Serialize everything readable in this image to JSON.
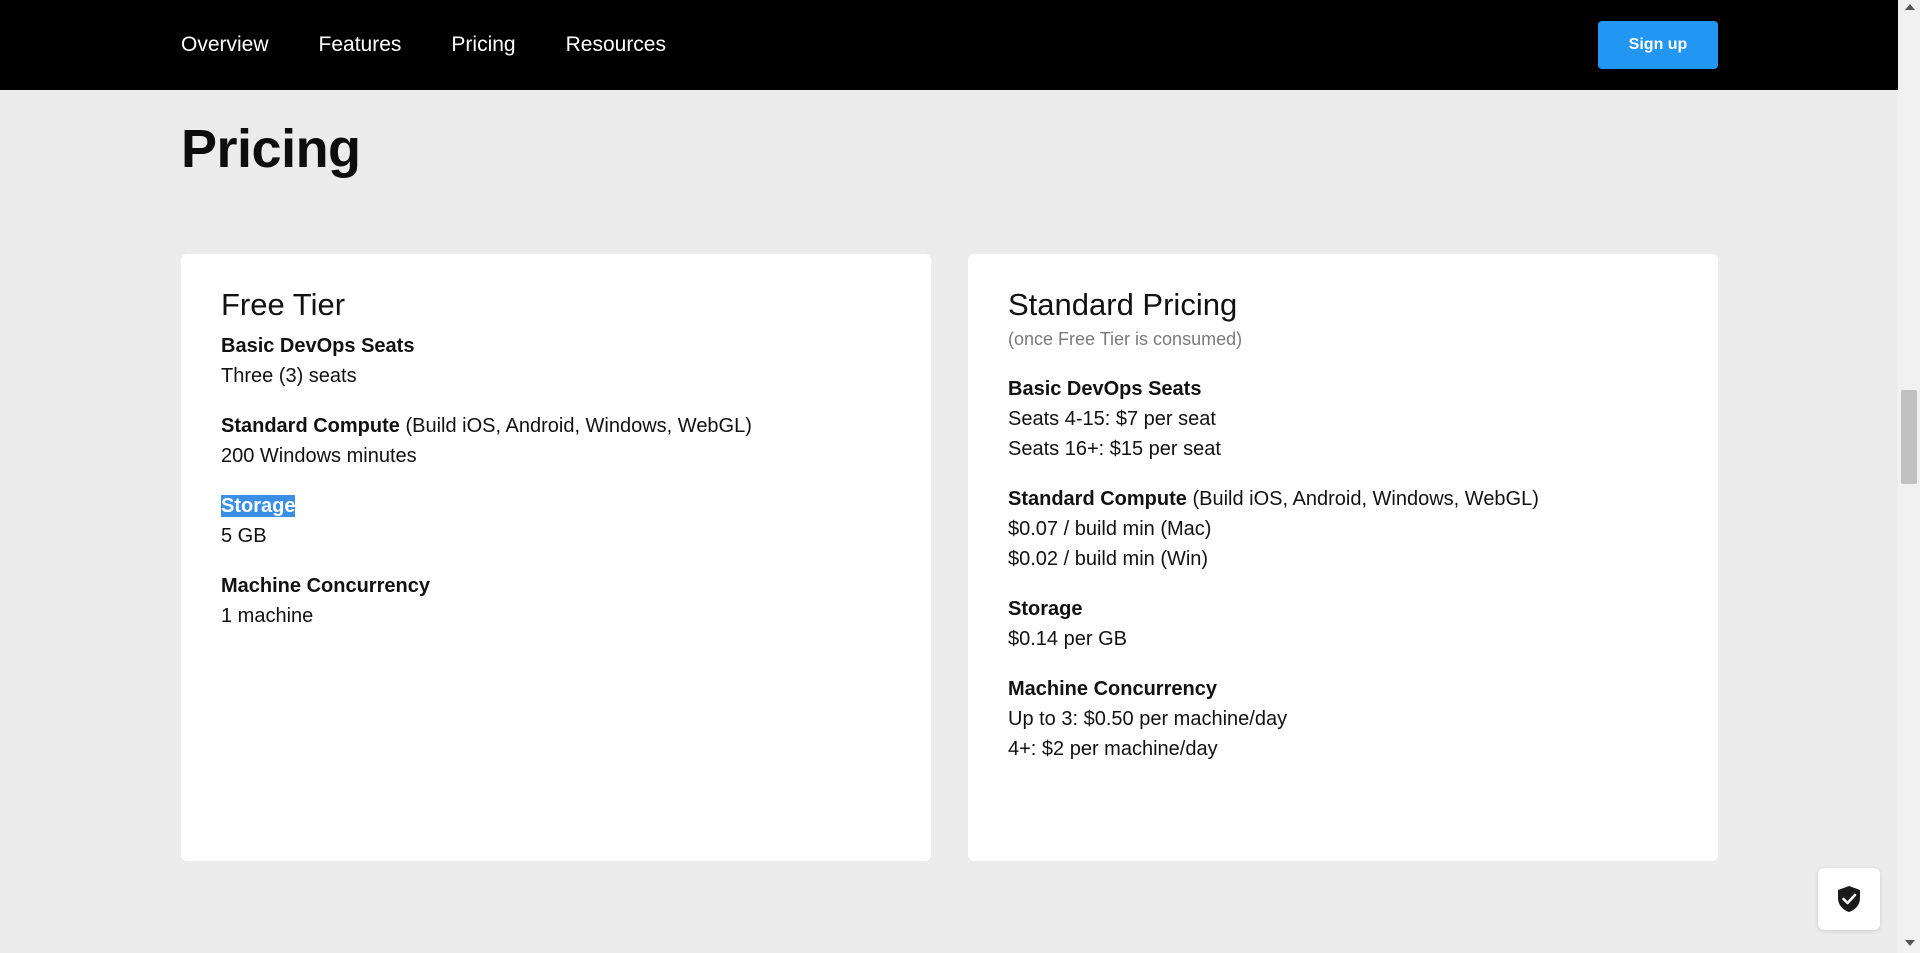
{
  "nav": {
    "links": [
      "Overview",
      "Features",
      "Pricing",
      "Resources"
    ],
    "signup_label": "Sign up"
  },
  "page": {
    "title": "Pricing"
  },
  "free_tier": {
    "title": "Free Tier",
    "items": [
      {
        "label": "Basic DevOps Seats",
        "note": "",
        "values": [
          "Three (3) seats"
        ]
      },
      {
        "label": "Standard Compute",
        "note": " (Build iOS, Android, Windows, WebGL)",
        "values": [
          "200 Windows minutes"
        ]
      },
      {
        "label": "Storage",
        "note": "",
        "values": [
          "5 GB"
        ]
      },
      {
        "label": "Machine Concurrency",
        "note": "",
        "values": [
          "1 machine"
        ]
      }
    ]
  },
  "standard": {
    "title": "Standard Pricing",
    "subtitle": "(once Free Tier is consumed)",
    "items": [
      {
        "label": "Basic DevOps Seats",
        "note": "",
        "values": [
          "Seats 4-15: $7 per seat",
          "Seats 16+: $15 per seat"
        ]
      },
      {
        "label": "Standard Compute",
        "note": " (Build iOS, Android, Windows, WebGL)",
        "values": [
          "$0.07 / build min (Mac)",
          "$0.02 / build min (Win)"
        ]
      },
      {
        "label": "Storage",
        "note": "",
        "values": [
          "$0.14 per GB"
        ]
      },
      {
        "label": "Machine Concurrency",
        "note": "",
        "values": [
          "Up to 3: $0.50 per machine/day",
          "4+: $2 per machine/day"
        ]
      }
    ]
  },
  "colors": {
    "nav_bg": "#000000",
    "accent": "#2196f3",
    "page_bg": "#ececec",
    "selection": "#3a8ee6"
  },
  "icons": {
    "badge": "shield-check-icon"
  }
}
